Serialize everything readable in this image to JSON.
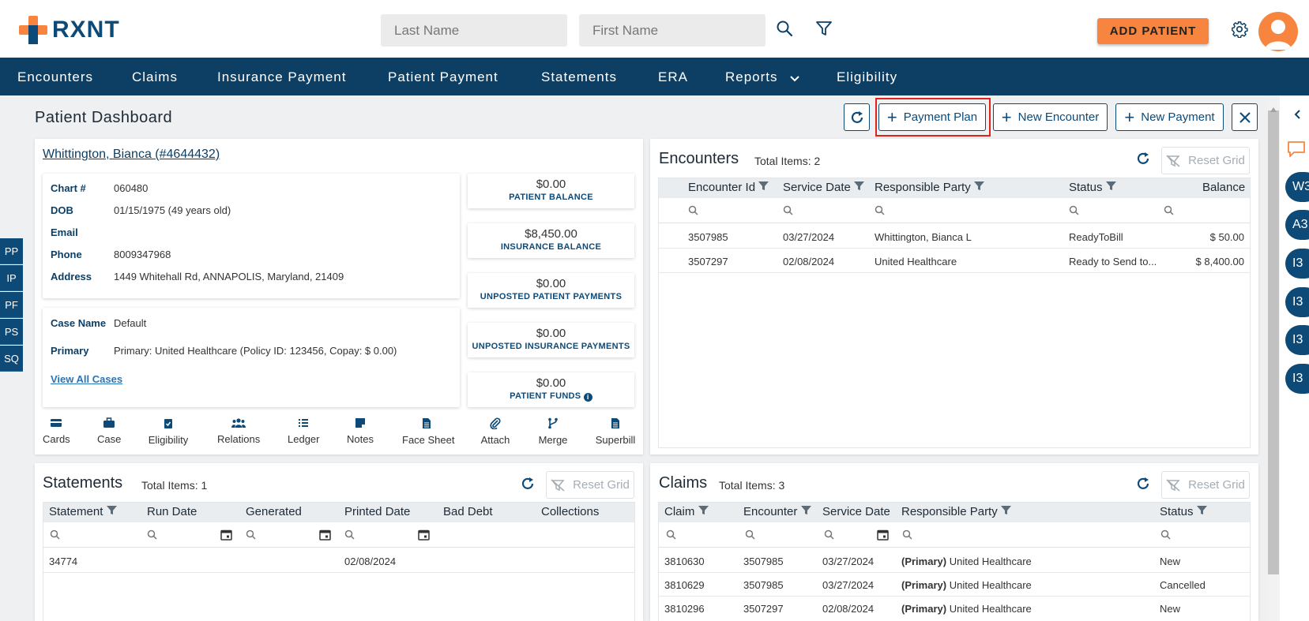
{
  "header": {
    "logo_text": "RXNT",
    "last_name_placeholder": "Last Name",
    "first_name_placeholder": "First Name",
    "add_patient_label": "ADD PATIENT"
  },
  "nav": {
    "items": [
      "Encounters",
      "Claims",
      "Insurance Payment",
      "Patient Payment",
      "Statements",
      "ERA",
      "Reports",
      "Eligibility"
    ]
  },
  "page": {
    "title": "Patient Dashboard",
    "buttons": {
      "payment_plan": "Payment Plan",
      "new_encounter": "New Encounter",
      "new_payment": "New Payment"
    }
  },
  "patient": {
    "name": "Whittington, Bianca (#4644432)",
    "labels": {
      "chart": "Chart #",
      "dob": "DOB",
      "email": "Email",
      "phone": "Phone",
      "address": "Address",
      "case_name": "Case Name",
      "primary": "Primary"
    },
    "chart": "060480",
    "dob": "01/15/1975 (49 years old)",
    "email": "",
    "phone": "8009347968",
    "address": "1449 Whitehall Rd, ANNAPOLIS, Maryland, 21409",
    "case_name": "Default",
    "primary": "Primary: United Healthcare (Policy ID: 123456, Copay: $ 0.00)",
    "view_all_cases": "View All Cases"
  },
  "balances": [
    {
      "amount": "$0.00",
      "label": "PATIENT BALANCE"
    },
    {
      "amount": "$8,450.00",
      "label": "INSURANCE BALANCE"
    },
    {
      "amount": "$0.00",
      "label": "UNPOSTED PATIENT PAYMENTS"
    },
    {
      "amount": "$0.00",
      "label": "UNPOSTED INSURANCE PAYMENTS"
    },
    {
      "amount": "$0.00",
      "label": "PATIENT FUNDS"
    }
  ],
  "actions": [
    "Cards",
    "Case",
    "Eligibility",
    "Relations",
    "Ledger",
    "Notes",
    "Face Sheet",
    "Attach",
    "Merge",
    "Superbill"
  ],
  "side_tabs": [
    "PP",
    "IP",
    "PF",
    "PS",
    "SQ"
  ],
  "encounters": {
    "title": "Encounters",
    "total": "Total Items: 2",
    "reset": "Reset Grid",
    "headers": [
      "Encounter Id",
      "Service Date",
      "Responsible Party",
      "Status",
      "Balance"
    ],
    "rows": [
      [
        "3507985",
        "03/27/2024",
        "Whittington, Bianca L",
        "ReadyToBill",
        "$ 50.00"
      ],
      [
        "3507297",
        "02/08/2024",
        "United Healthcare",
        "Ready to Send to...",
        "$ 8,400.00"
      ]
    ]
  },
  "statements": {
    "title": "Statements",
    "total": "Total Items: 1",
    "reset": "Reset Grid",
    "headers": [
      "Statement",
      "Run Date",
      "Generated",
      "Printed Date",
      "Bad Debt",
      "Collections"
    ],
    "rows": [
      [
        "34774",
        "",
        "",
        "02/08/2024",
        "",
        ""
      ]
    ]
  },
  "claims": {
    "title": "Claims",
    "total": "Total Items: 3",
    "reset": "Reset Grid",
    "headers": [
      "Claim",
      "Encounter",
      "Service Date",
      "Responsible Party",
      "Status"
    ],
    "primary_tag": "(Primary)",
    "rows": [
      [
        "3810630",
        "3507985",
        "03/27/2024",
        "United Healthcare",
        "New"
      ],
      [
        "3810629",
        "3507985",
        "03/27/2024",
        "United Healthcare",
        "Cancelled"
      ],
      [
        "3810296",
        "3507297",
        "02/08/2024",
        "United Healthcare",
        "New"
      ]
    ]
  },
  "right_rail": [
    "W3",
    "A3",
    "I3",
    "I3",
    "I3",
    "I3"
  ],
  "colors": {
    "brand_navy": "#0d3f64",
    "brand_orange": "#f7853f",
    "link_blue": "#2a74b8",
    "highlight_red": "#e2231a"
  }
}
